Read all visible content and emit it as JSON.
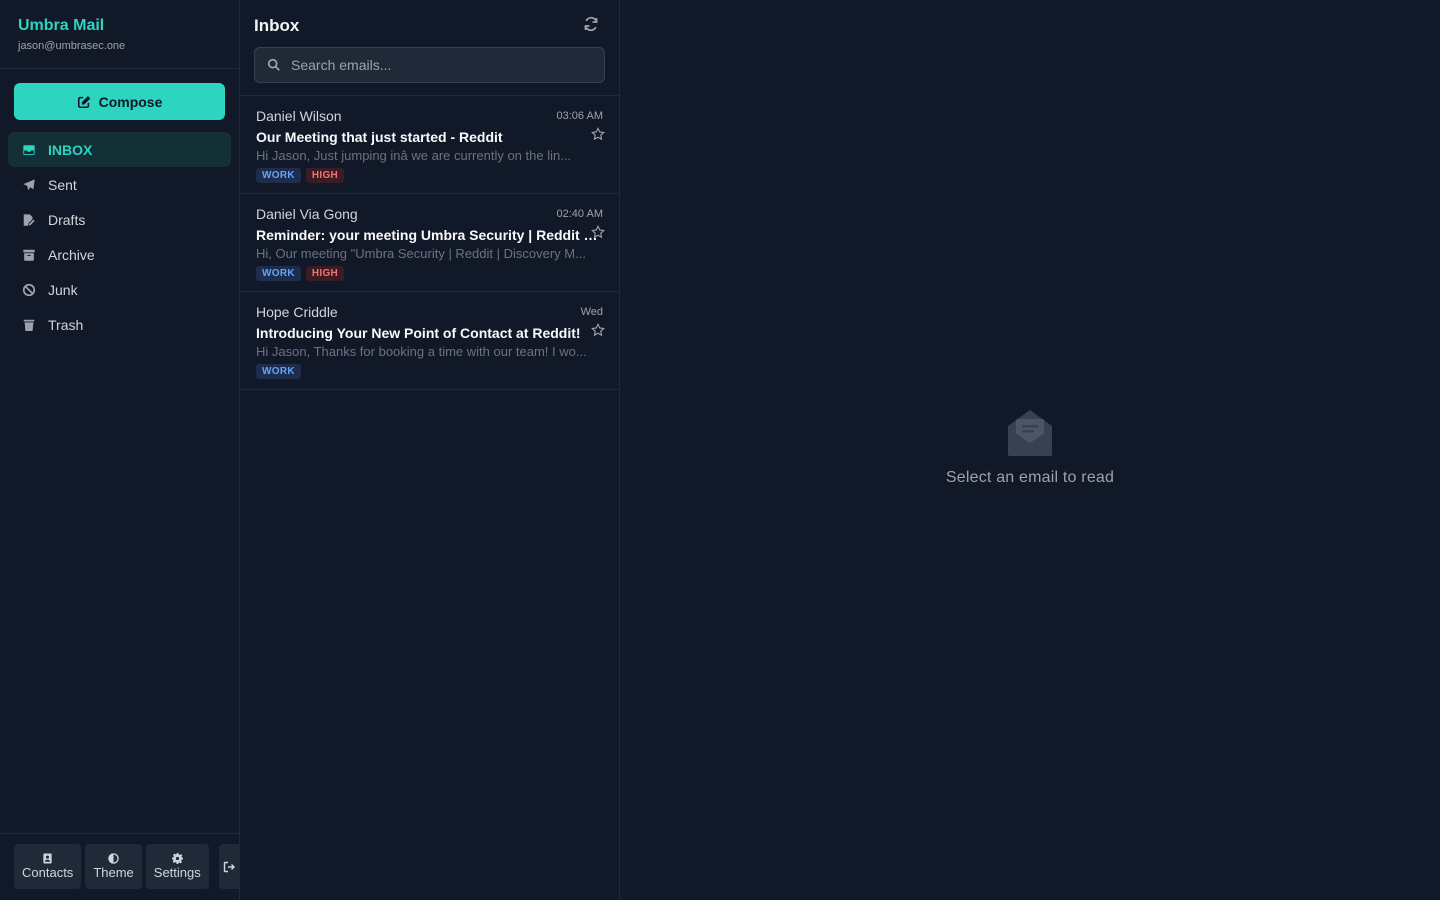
{
  "brand": {
    "name": "Umbra Mail",
    "email": "jason@umbrasec.one"
  },
  "compose": {
    "label": "Compose"
  },
  "nav": [
    {
      "id": "inbox",
      "label": "INBOX",
      "icon": "inbox-icon",
      "active": true
    },
    {
      "id": "sent",
      "label": "Sent",
      "icon": "send-icon",
      "active": false
    },
    {
      "id": "drafts",
      "label": "Drafts",
      "icon": "draft-icon",
      "active": false
    },
    {
      "id": "archive",
      "label": "Archive",
      "icon": "archive-icon",
      "active": false
    },
    {
      "id": "junk",
      "label": "Junk",
      "icon": "ban-icon",
      "active": false
    },
    {
      "id": "trash",
      "label": "Trash",
      "icon": "trash-icon",
      "active": false
    }
  ],
  "bottom": {
    "contacts": "Contacts",
    "theme": "Theme",
    "settings": "Settings"
  },
  "list": {
    "title": "Inbox",
    "search_placeholder": "Search emails...",
    "emails": [
      {
        "sender": "Daniel Wilson",
        "time": "03:06 AM",
        "subject": "Our Meeting that just started - Reddit",
        "preview": "Hi Jason, Just jumping inâ we are currently on the lin...",
        "tags": [
          "WORK",
          "HIGH"
        ]
      },
      {
        "sender": "Daniel Via Gong",
        "time": "02:40 AM",
        "subject": "Reminder: your meeting Umbra Security | Reddit | Discovery Meeting",
        "preview": "Hi, Our meeting \"Umbra Security | Reddit | Discovery M...",
        "tags": [
          "WORK",
          "HIGH"
        ]
      },
      {
        "sender": "Hope Criddle",
        "time": "Wed",
        "subject": "Introducing Your New Point of Contact at Reddit!",
        "preview": "Hi Jason, Thanks for booking a time with our team! I wo...",
        "tags": [
          "WORK"
        ]
      }
    ]
  },
  "reader": {
    "empty_text": "Select an email to read",
    "icon": "envelope-open-icon"
  },
  "colors": {
    "accent": "#2dd4bf",
    "background": "#111827",
    "tag_work": "#60a5fa",
    "tag_high": "#f87171"
  }
}
